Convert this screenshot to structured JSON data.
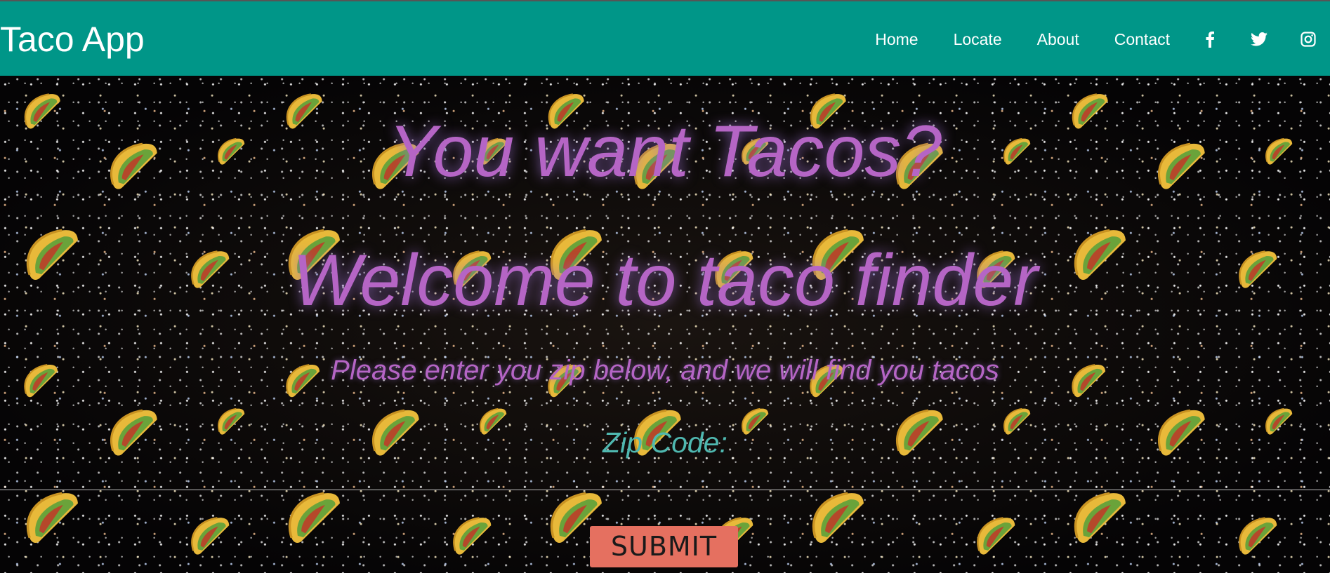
{
  "navbar": {
    "brand": "Taco App",
    "links": [
      "Home",
      "Locate",
      "About",
      "Contact"
    ],
    "social_icons": [
      "facebook-icon",
      "twitter-icon",
      "instagram-icon"
    ],
    "bg_color": "#009688"
  },
  "hero": {
    "headline_1": "You want Tacos?",
    "headline_2": "Welcome to taco finder",
    "subtitle": "Please enter you zip below, and we will find you tacos",
    "zip_label": "Zip Code:",
    "zip_value": "",
    "submit_label": "SUBMIT",
    "background": "starfield-with-tacos",
    "text_color": "#b565c5",
    "label_color": "#4fb8b0",
    "button_color": "#e57060"
  }
}
